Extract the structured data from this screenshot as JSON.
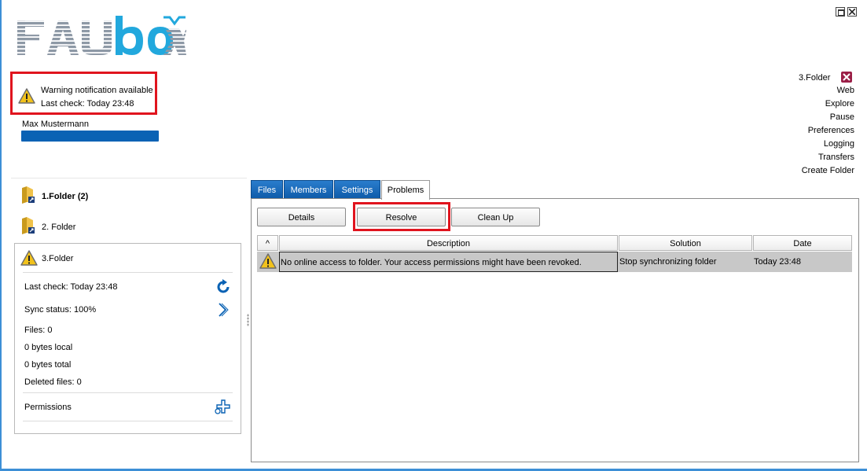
{
  "app": {
    "logo_text": "FAUbox",
    "colors": {
      "accent": "#0a62b4",
      "logo_blue": "#22a8dd",
      "logo_gray": "#8e99a6",
      "highlight_red": "#e0141e",
      "row_selected": "#c8c8c8"
    }
  },
  "notification": {
    "icon": "warning-icon",
    "line1": "Warning notification available",
    "line2": "Last check: Today 23:48"
  },
  "user": {
    "name": "Max Mustermann"
  },
  "right_menu": {
    "selected_folder": "3.Folder",
    "items": [
      "Web",
      "Explore",
      "Pause",
      "Preferences",
      "Logging",
      "Transfers",
      "Create Folder"
    ]
  },
  "folders": [
    {
      "name": "1.Folder (2)"
    },
    {
      "name": "2. Folder"
    },
    {
      "name": "3.Folder"
    }
  ],
  "folder_details": {
    "last_check": "Last check: Today 23:48",
    "sync_status": "Sync status: 100%",
    "files": "Files: 0",
    "bytes_local": "0 bytes local",
    "bytes_total": "0 bytes total",
    "deleted_files": "Deleted files: 0",
    "permissions": "Permissions"
  },
  "tabs": [
    "Files",
    "Members",
    "Settings",
    "Problems"
  ],
  "active_tab": "Problems",
  "toolbar": {
    "details": "Details",
    "resolve": "Resolve",
    "clean_up": "Clean Up"
  },
  "problems_table": {
    "sort_indicator": "^",
    "columns": [
      "Description",
      "Solution",
      "Date"
    ],
    "rows": [
      {
        "description": "No online access to folder. Your access permissions might have been revoked.",
        "solution": "Stop synchronizing folder",
        "date": "Today 23:48"
      }
    ]
  }
}
